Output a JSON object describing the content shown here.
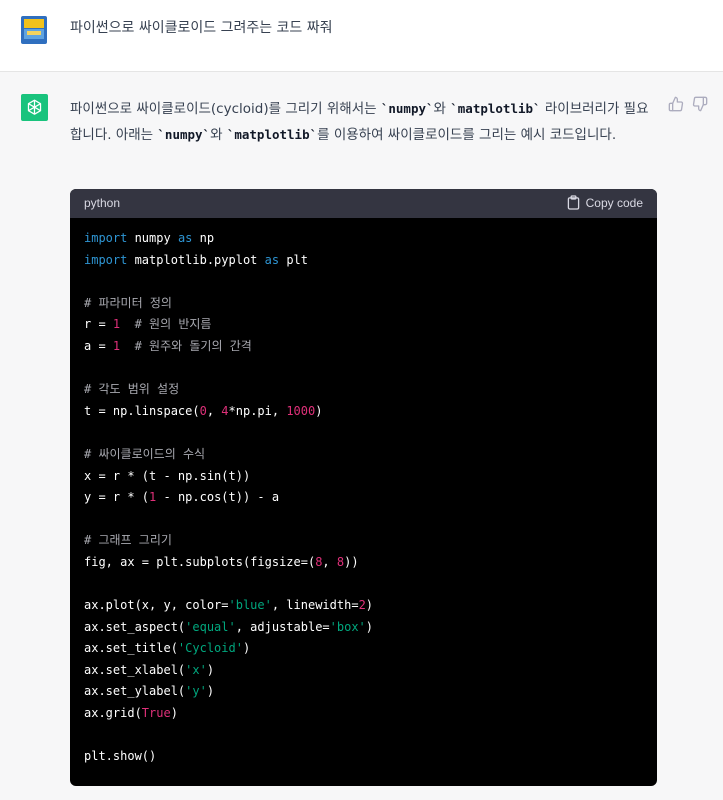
{
  "user": {
    "message": "파이썬으로 싸이클로이드 그려주는 코드 짜줘"
  },
  "assistant": {
    "intro": [
      {
        "t": "text",
        "v": "파이썬으로 싸이클로이드(cycloid)를 그리기 위해서는 "
      },
      {
        "t": "code",
        "v": "`numpy`"
      },
      {
        "t": "text",
        "v": "와 "
      },
      {
        "t": "code",
        "v": "`matplotlib`"
      },
      {
        "t": "text",
        "v": " 라이브러리가 필요합니다. 아래는 "
      },
      {
        "t": "code",
        "v": "`numpy`"
      },
      {
        "t": "text",
        "v": "와 "
      },
      {
        "t": "code",
        "v": "`matplotlib`"
      },
      {
        "t": "text",
        "v": "를 이용하여 싸이클로이드를 그리는 예시 코드입니다."
      }
    ],
    "code_block": {
      "language": "python",
      "copy_label": "Copy code",
      "lines": [
        [
          {
            "t": "kw",
            "v": "import"
          },
          {
            "t": "plain",
            "v": " numpy "
          },
          {
            "t": "kw",
            "v": "as"
          },
          {
            "t": "plain",
            "v": " np"
          }
        ],
        [
          {
            "t": "kw",
            "v": "import"
          },
          {
            "t": "plain",
            "v": " matplotlib.pyplot "
          },
          {
            "t": "kw",
            "v": "as"
          },
          {
            "t": "plain",
            "v": " plt"
          }
        ],
        [],
        [
          {
            "t": "cmt",
            "v": "# 파라미터 정의"
          }
        ],
        [
          {
            "t": "plain",
            "v": "r = "
          },
          {
            "t": "num",
            "v": "1"
          },
          {
            "t": "plain",
            "v": "  "
          },
          {
            "t": "cmt",
            "v": "# 원의 반지름"
          }
        ],
        [
          {
            "t": "plain",
            "v": "a = "
          },
          {
            "t": "num",
            "v": "1"
          },
          {
            "t": "plain",
            "v": "  "
          },
          {
            "t": "cmt",
            "v": "# 원주와 돌기의 간격"
          }
        ],
        [],
        [
          {
            "t": "cmt",
            "v": "# 각도 범위 설정"
          }
        ],
        [
          {
            "t": "plain",
            "v": "t = np.linspace("
          },
          {
            "t": "num",
            "v": "0"
          },
          {
            "t": "plain",
            "v": ", "
          },
          {
            "t": "num",
            "v": "4"
          },
          {
            "t": "plain",
            "v": "*np.pi, "
          },
          {
            "t": "num",
            "v": "1000"
          },
          {
            "t": "plain",
            "v": ")"
          }
        ],
        [],
        [
          {
            "t": "cmt",
            "v": "# 싸이클로이드의 수식"
          }
        ],
        [
          {
            "t": "plain",
            "v": "x = r * (t - np.sin(t))"
          }
        ],
        [
          {
            "t": "plain",
            "v": "y = r * ("
          },
          {
            "t": "num",
            "v": "1"
          },
          {
            "t": "plain",
            "v": " - np.cos(t)) - a"
          }
        ],
        [],
        [
          {
            "t": "cmt",
            "v": "# 그래프 그리기"
          }
        ],
        [
          {
            "t": "plain",
            "v": "fig, ax = plt.subplots(figsize=("
          },
          {
            "t": "num",
            "v": "8"
          },
          {
            "t": "plain",
            "v": ", "
          },
          {
            "t": "num",
            "v": "8"
          },
          {
            "t": "plain",
            "v": "))"
          }
        ],
        [],
        [
          {
            "t": "plain",
            "v": "ax.plot(x, y, color="
          },
          {
            "t": "str",
            "v": "'blue'"
          },
          {
            "t": "plain",
            "v": ", linewidth="
          },
          {
            "t": "num",
            "v": "2"
          },
          {
            "t": "plain",
            "v": ")"
          }
        ],
        [
          {
            "t": "plain",
            "v": "ax.set_aspect("
          },
          {
            "t": "str",
            "v": "'equal'"
          },
          {
            "t": "plain",
            "v": ", adjustable="
          },
          {
            "t": "str",
            "v": "'box'"
          },
          {
            "t": "plain",
            "v": ")"
          }
        ],
        [
          {
            "t": "plain",
            "v": "ax.set_title("
          },
          {
            "t": "str",
            "v": "'Cycloid'"
          },
          {
            "t": "plain",
            "v": ")"
          }
        ],
        [
          {
            "t": "plain",
            "v": "ax.set_xlabel("
          },
          {
            "t": "str",
            "v": "'x'"
          },
          {
            "t": "plain",
            "v": ")"
          }
        ],
        [
          {
            "t": "plain",
            "v": "ax.set_ylabel("
          },
          {
            "t": "str",
            "v": "'y'"
          },
          {
            "t": "plain",
            "v": ")"
          }
        ],
        [
          {
            "t": "plain",
            "v": "ax.grid("
          },
          {
            "t": "num",
            "v": "True"
          },
          {
            "t": "plain",
            "v": ")"
          }
        ],
        [],
        [
          {
            "t": "plain",
            "v": "plt.show()"
          }
        ]
      ]
    }
  },
  "icons": {
    "user_avatar": "user-avatar-image",
    "bot_avatar": "openai-logo-icon",
    "thumbs_up": "thumbs-up-icon",
    "thumbs_down": "thumbs-down-icon",
    "copy": "clipboard-icon"
  },
  "colors": {
    "page_bg": "#f7f7f8",
    "user_row_bg": "#ffffff",
    "bot_avatar_bg": "#19c37d",
    "code_bg": "#000000",
    "code_header_bg": "#343541",
    "keyword": "#2e95d3",
    "number": "#df3079",
    "string": "#00a67d",
    "comment": "#a9aab1"
  }
}
